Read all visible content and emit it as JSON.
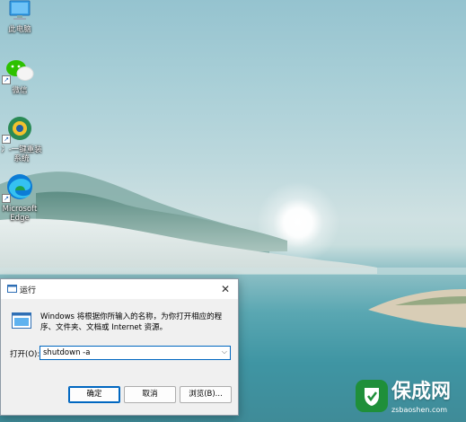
{
  "desktop": {
    "icons": [
      {
        "id": "this-pc",
        "label": "此电脑",
        "shortcut": false
      },
      {
        "id": "wechat",
        "label": "微信",
        "shortcut": true
      },
      {
        "id": "reinstall",
        "label": "冫-一键重装系统",
        "shortcut": true
      },
      {
        "id": "edge",
        "label": "Microsoft Edge",
        "shortcut": true
      }
    ]
  },
  "run_dialog": {
    "title": "运行",
    "close_label": "✕",
    "description": "Windows 将根据你所输入的名称，为你打开相应的程序、文件夹、文档或 Internet 资源。",
    "open_label": "打开(O):",
    "input_value": "shutdown -a",
    "ok_label": "确定",
    "cancel_label": "取消",
    "browse_label": "浏览(B)..."
  },
  "watermark": {
    "title": "保成网",
    "subtitle": "zsbaoshen.com"
  },
  "colors": {
    "accent": "#0067c0",
    "dialog_bg": "#f0f0f0",
    "watermark_green": "#1f8f3a"
  }
}
